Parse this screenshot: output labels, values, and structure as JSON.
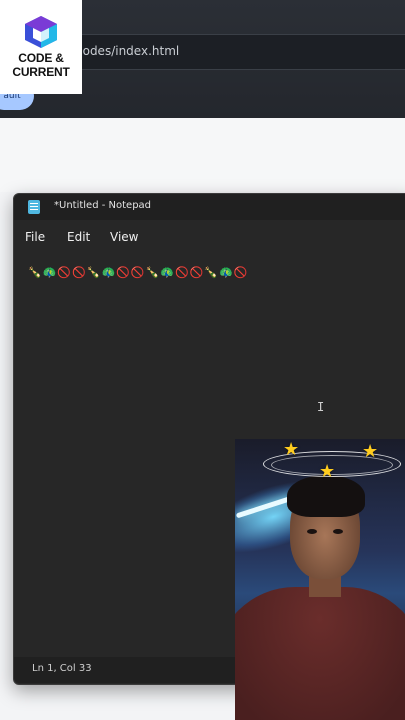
{
  "browser": {
    "url_fragment": "codes/index.html",
    "pill_label": "ault"
  },
  "logo": {
    "line1": "CODE &",
    "line2": "CURRENT",
    "colors": [
      "#3a4fd8",
      "#7a3bd6",
      "#22b8e8"
    ]
  },
  "notepad": {
    "title": "*Untitled - Notepad",
    "menu": [
      "File",
      "Edit",
      "View"
    ],
    "content": "🍾🦚🚫🚫🍾🦚🚫🚫🍾🦚🚫🚫🍾🦚🚫",
    "cursor_glyph": "I",
    "status": "Ln 1, Col 33"
  },
  "webcam": {
    "effect": "dizzy-stars-halo"
  }
}
